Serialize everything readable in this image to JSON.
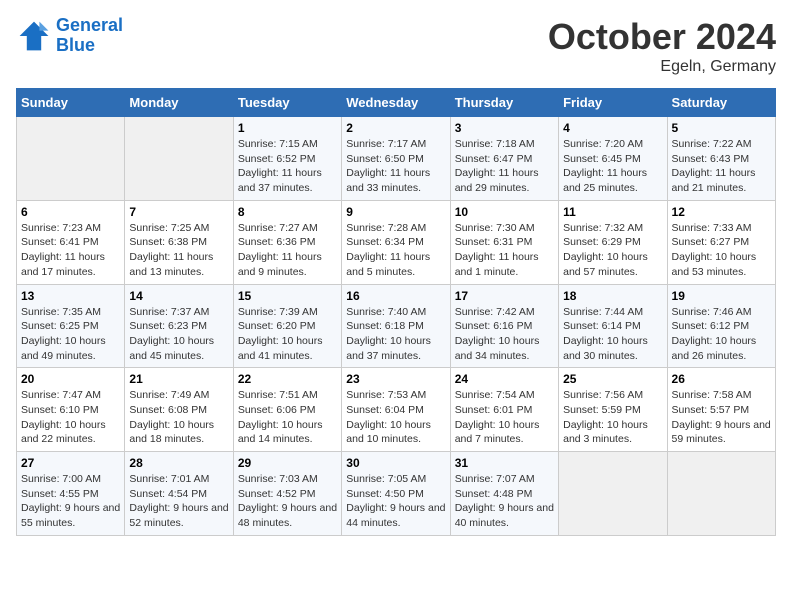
{
  "logo": {
    "line1": "General",
    "line2": "Blue"
  },
  "title": "October 2024",
  "location": "Egeln, Germany",
  "days_header": [
    "Sunday",
    "Monday",
    "Tuesday",
    "Wednesday",
    "Thursday",
    "Friday",
    "Saturday"
  ],
  "weeks": [
    [
      {
        "day": "",
        "empty": true
      },
      {
        "day": "",
        "empty": true
      },
      {
        "day": "1",
        "sunrise": "7:15 AM",
        "sunset": "6:52 PM",
        "daylight": "11 hours and 37 minutes."
      },
      {
        "day": "2",
        "sunrise": "7:17 AM",
        "sunset": "6:50 PM",
        "daylight": "11 hours and 33 minutes."
      },
      {
        "day": "3",
        "sunrise": "7:18 AM",
        "sunset": "6:47 PM",
        "daylight": "11 hours and 29 minutes."
      },
      {
        "day": "4",
        "sunrise": "7:20 AM",
        "sunset": "6:45 PM",
        "daylight": "11 hours and 25 minutes."
      },
      {
        "day": "5",
        "sunrise": "7:22 AM",
        "sunset": "6:43 PM",
        "daylight": "11 hours and 21 minutes."
      }
    ],
    [
      {
        "day": "6",
        "sunrise": "7:23 AM",
        "sunset": "6:41 PM",
        "daylight": "11 hours and 17 minutes."
      },
      {
        "day": "7",
        "sunrise": "7:25 AM",
        "sunset": "6:38 PM",
        "daylight": "11 hours and 13 minutes."
      },
      {
        "day": "8",
        "sunrise": "7:27 AM",
        "sunset": "6:36 PM",
        "daylight": "11 hours and 9 minutes."
      },
      {
        "day": "9",
        "sunrise": "7:28 AM",
        "sunset": "6:34 PM",
        "daylight": "11 hours and 5 minutes."
      },
      {
        "day": "10",
        "sunrise": "7:30 AM",
        "sunset": "6:31 PM",
        "daylight": "11 hours and 1 minute."
      },
      {
        "day": "11",
        "sunrise": "7:32 AM",
        "sunset": "6:29 PM",
        "daylight": "10 hours and 57 minutes."
      },
      {
        "day": "12",
        "sunrise": "7:33 AM",
        "sunset": "6:27 PM",
        "daylight": "10 hours and 53 minutes."
      }
    ],
    [
      {
        "day": "13",
        "sunrise": "7:35 AM",
        "sunset": "6:25 PM",
        "daylight": "10 hours and 49 minutes."
      },
      {
        "day": "14",
        "sunrise": "7:37 AM",
        "sunset": "6:23 PM",
        "daylight": "10 hours and 45 minutes."
      },
      {
        "day": "15",
        "sunrise": "7:39 AM",
        "sunset": "6:20 PM",
        "daylight": "10 hours and 41 minutes."
      },
      {
        "day": "16",
        "sunrise": "7:40 AM",
        "sunset": "6:18 PM",
        "daylight": "10 hours and 37 minutes."
      },
      {
        "day": "17",
        "sunrise": "7:42 AM",
        "sunset": "6:16 PM",
        "daylight": "10 hours and 34 minutes."
      },
      {
        "day": "18",
        "sunrise": "7:44 AM",
        "sunset": "6:14 PM",
        "daylight": "10 hours and 30 minutes."
      },
      {
        "day": "19",
        "sunrise": "7:46 AM",
        "sunset": "6:12 PM",
        "daylight": "10 hours and 26 minutes."
      }
    ],
    [
      {
        "day": "20",
        "sunrise": "7:47 AM",
        "sunset": "6:10 PM",
        "daylight": "10 hours and 22 minutes."
      },
      {
        "day": "21",
        "sunrise": "7:49 AM",
        "sunset": "6:08 PM",
        "daylight": "10 hours and 18 minutes."
      },
      {
        "day": "22",
        "sunrise": "7:51 AM",
        "sunset": "6:06 PM",
        "daylight": "10 hours and 14 minutes."
      },
      {
        "day": "23",
        "sunrise": "7:53 AM",
        "sunset": "6:04 PM",
        "daylight": "10 hours and 10 minutes."
      },
      {
        "day": "24",
        "sunrise": "7:54 AM",
        "sunset": "6:01 PM",
        "daylight": "10 hours and 7 minutes."
      },
      {
        "day": "25",
        "sunrise": "7:56 AM",
        "sunset": "5:59 PM",
        "daylight": "10 hours and 3 minutes."
      },
      {
        "day": "26",
        "sunrise": "7:58 AM",
        "sunset": "5:57 PM",
        "daylight": "9 hours and 59 minutes."
      }
    ],
    [
      {
        "day": "27",
        "sunrise": "7:00 AM",
        "sunset": "4:55 PM",
        "daylight": "9 hours and 55 minutes."
      },
      {
        "day": "28",
        "sunrise": "7:01 AM",
        "sunset": "4:54 PM",
        "daylight": "9 hours and 52 minutes."
      },
      {
        "day": "29",
        "sunrise": "7:03 AM",
        "sunset": "4:52 PM",
        "daylight": "9 hours and 48 minutes."
      },
      {
        "day": "30",
        "sunrise": "7:05 AM",
        "sunset": "4:50 PM",
        "daylight": "9 hours and 44 minutes."
      },
      {
        "day": "31",
        "sunrise": "7:07 AM",
        "sunset": "4:48 PM",
        "daylight": "9 hours and 40 minutes."
      },
      {
        "day": "",
        "empty": true
      },
      {
        "day": "",
        "empty": true
      }
    ]
  ]
}
